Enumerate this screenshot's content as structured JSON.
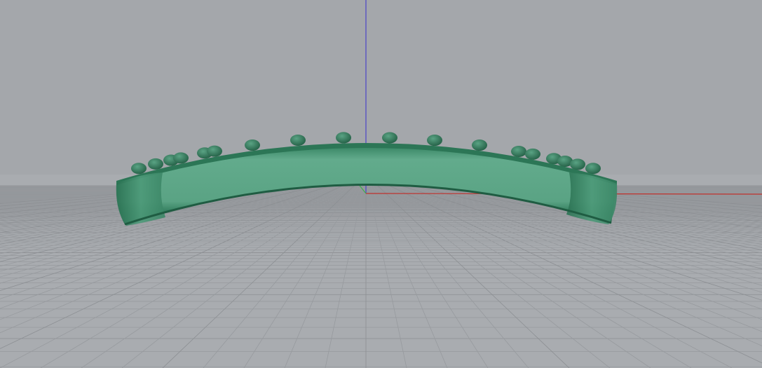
{
  "viewport": {
    "type": "perspective",
    "colors": {
      "background": "#a4a7ab",
      "floor": "#a9acb0",
      "grid_line": "#979a9e",
      "grid_major": "#8c8f93",
      "axis_x": "#c0312c",
      "axis_y": "#3fae4a",
      "axis_z": "#4a44c8",
      "model_face": "#5ca586",
      "model_rim": "#2c7656",
      "model_shadow": "#1f5c42"
    },
    "icons": [
      "world-axes-icon"
    ],
    "model": "curved-band-with-bumps"
  }
}
